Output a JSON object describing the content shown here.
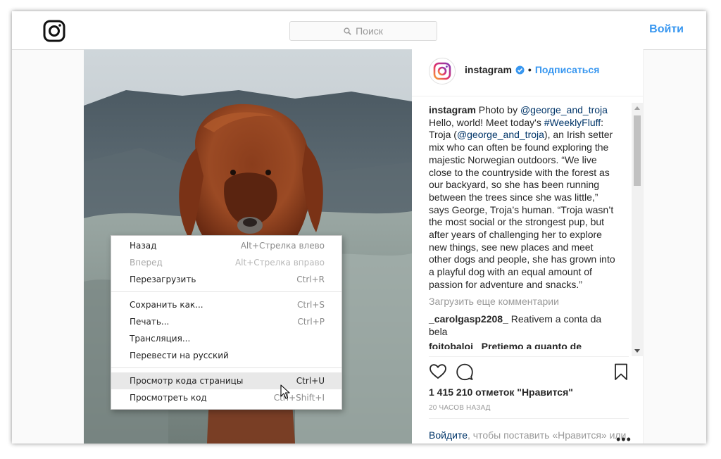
{
  "header": {
    "search_placeholder": "Поиск",
    "login_label": "Войти"
  },
  "post": {
    "username": "instagram",
    "dot": "•",
    "follow_label": "Подписаться",
    "caption": {
      "author": "instagram",
      "t1": " Photo by ",
      "m1": "@george_and_troja",
      "t2": " Hello, world! Meet today's ",
      "h1": "#WeeklyFluff",
      "t3": ": Troja (",
      "m2": "@george_and_troja",
      "t4": "), an Irish setter mix who can often be found exploring the majestic Norwegian outdoors. “We live close to the countryside with the forest as our backyard, so she has been running between the trees since she was little,” says George, Troja’s human. “Troja wasn’t the most social or the strongest pup, but after years of challenging her to explore new things, see new places and meet other dogs and people, she has grown into a playful dog with an equal amount of passion for adventure and snacks.”"
    },
    "load_more": "Загрузить еще комментарии",
    "comment": {
      "user": "_carolgasp2208_",
      "text": " Reativem a conta da bela"
    },
    "partial_comment": "foitobaloi_ Pretiemo a quanto de",
    "likes": "1 415 210 отметок \"Нравится\"",
    "time": "20 ЧАСОВ НАЗАД",
    "login_prompt": {
      "link": "Войдите",
      "text": ", чтобы поставить «Нравится» или прокомментировать."
    },
    "more": "•••"
  },
  "context_menu": {
    "items": [
      {
        "label": "Назад",
        "shortcut": "Alt+Стрелка влево"
      },
      {
        "label": "Вперед",
        "shortcut": "Alt+Стрелка вправо"
      },
      {
        "label": "Перезагрузить",
        "shortcut": "Ctrl+R"
      },
      {
        "label": "Сохранить как...",
        "shortcut": "Ctrl+S"
      },
      {
        "label": "Печать...",
        "shortcut": "Ctrl+P"
      },
      {
        "label": "Трансляция...",
        "shortcut": ""
      },
      {
        "label": "Перевести на русский",
        "shortcut": ""
      },
      {
        "label": "Просмотр кода страницы",
        "shortcut": "Ctrl+U"
      },
      {
        "label": "Просмотреть код",
        "shortcut": "Ctrl+Shift+I"
      }
    ]
  },
  "colors": {
    "accent": "#3897f0",
    "link": "#003569",
    "text": "#262626",
    "muted": "#999999"
  }
}
